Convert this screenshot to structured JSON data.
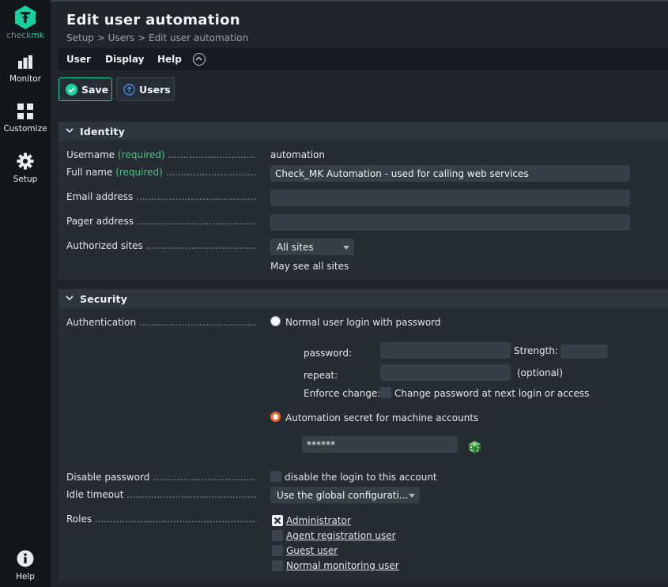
{
  "sidebar": {
    "logo_prefix": "check",
    "logo_suffix": "mk",
    "items": [
      {
        "label": "Monitor"
      },
      {
        "label": "Customize"
      },
      {
        "label": "Setup"
      },
      {
        "label": "Help"
      }
    ]
  },
  "page": {
    "title": "Edit user automation",
    "breadcrumb": [
      "Setup",
      "Users",
      "Edit user automation"
    ],
    "breadcrumb_sep": ">"
  },
  "menu": {
    "items": [
      "User",
      "Display",
      "Help"
    ]
  },
  "toolbar": {
    "save_label": "Save",
    "users_label": "Users"
  },
  "identity": {
    "header": "Identity",
    "username_label": "Username",
    "required": "(required)",
    "username_value": "automation",
    "fullname_label": "Full name",
    "fullname_value": "Check_MK Automation - used for calling web services",
    "email_label": "Email address",
    "email_value": "",
    "pager_label": "Pager address",
    "pager_value": "",
    "sites_label": "Authorized sites",
    "sites_value": "All sites",
    "sites_note": "May see all sites"
  },
  "security": {
    "header": "Security",
    "auth_label": "Authentication",
    "option_password": "Normal user login with password",
    "password_label": "password:",
    "strength_label": "Strength:",
    "repeat_label": "repeat:",
    "optional_label": "(optional)",
    "enforce_label": "Enforce change:",
    "enforce_text": "Change password at next login or access",
    "option_secret": "Automation secret for machine accounts",
    "secret_value": "******",
    "selected_auth": "secret",
    "disable_label": "Disable password",
    "disable_text": "disable the login to this account",
    "idle_label": "Idle timeout",
    "idle_value": "Use the global configurati...",
    "roles_label": "Roles",
    "roles": [
      {
        "name": "Administrator",
        "checked": true
      },
      {
        "name": "Agent registration user",
        "checked": false
      },
      {
        "name": "Guest user",
        "checked": false
      },
      {
        "name": "Normal monitoring user",
        "checked": false
      }
    ]
  },
  "colors": {
    "accent": "#15d1a0",
    "required": "#43c77f",
    "radio_selected": "#e9632a",
    "background": "#1f252b",
    "sidebar": "#12171c"
  }
}
